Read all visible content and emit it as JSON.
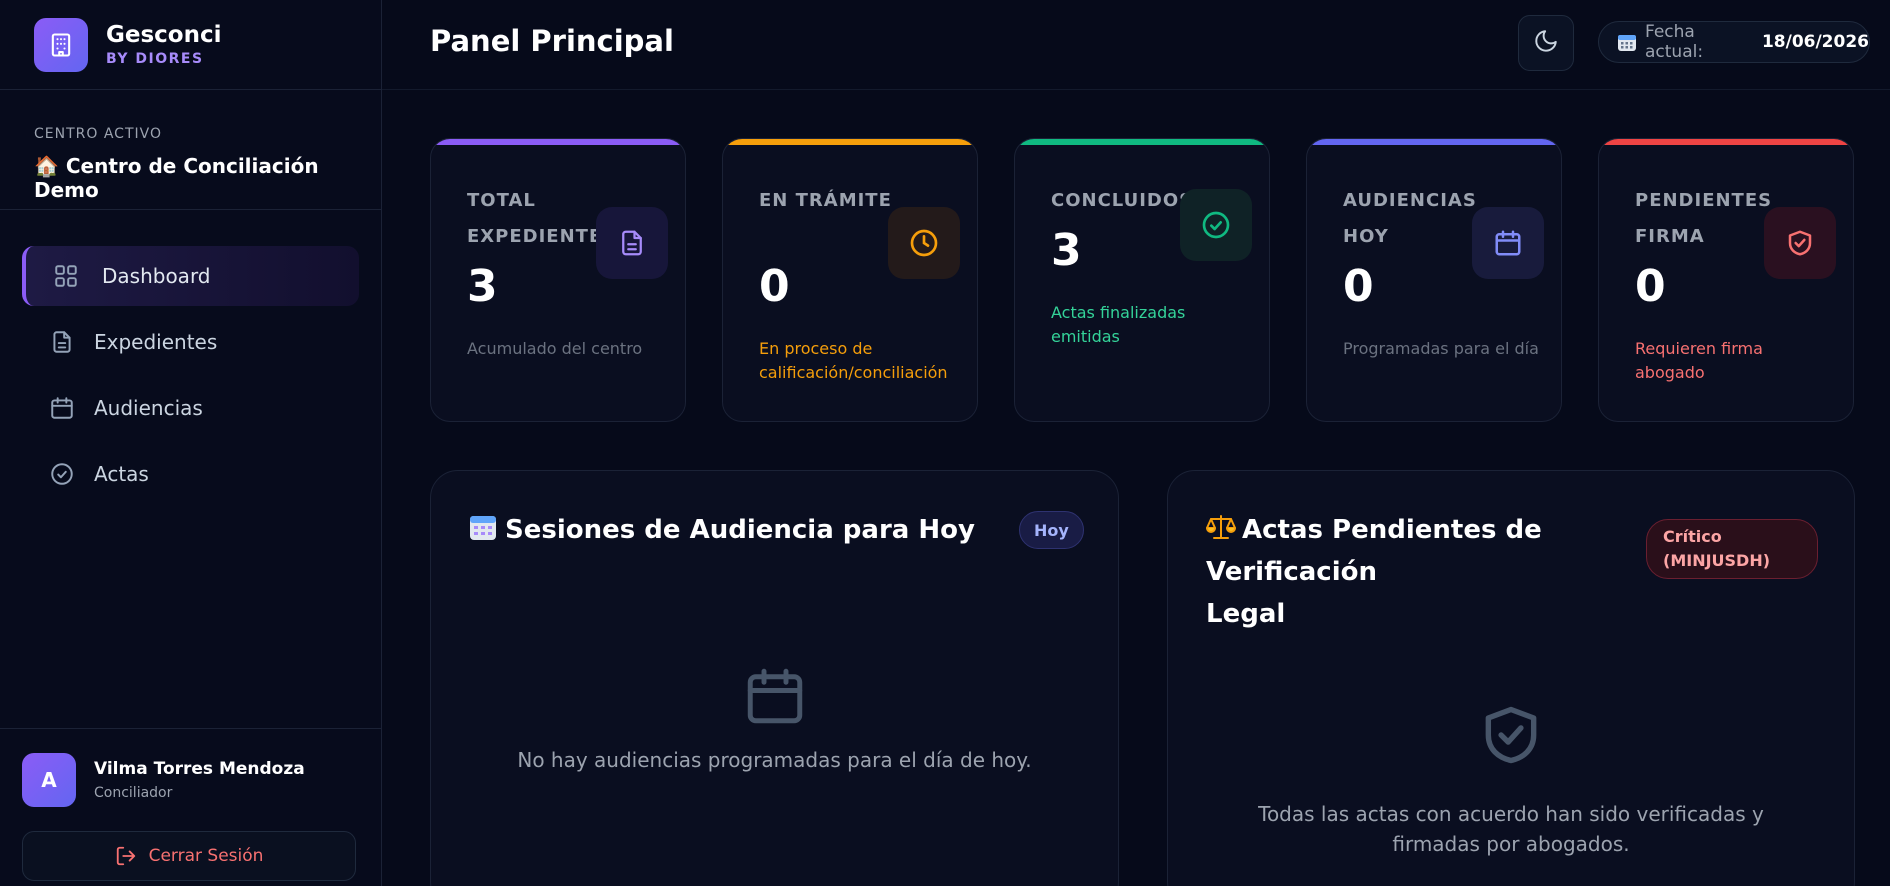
{
  "brand": {
    "name": "Gesconci",
    "subtitle": "BY DIORES"
  },
  "center": {
    "label": "CENTRO ACTIVO",
    "name": "🏠 Centro de Conciliación Demo"
  },
  "nav": [
    {
      "label": "Dashboard",
      "icon": "dashboard-grid-icon",
      "active": true
    },
    {
      "label": "Expedientes",
      "icon": "document-icon",
      "active": false
    },
    {
      "label": "Audiencias",
      "icon": "calendar-icon",
      "active": false
    },
    {
      "label": "Actas",
      "icon": "check-circle-icon",
      "active": false
    }
  ],
  "user": {
    "initial": "A",
    "name": "Vilma Torres Mendoza",
    "role": "Conciliador"
  },
  "logout": {
    "label": "Cerrar Sesión"
  },
  "header": {
    "title": "Panel Principal",
    "date_label": "Fecha actual:",
    "date_value": "18/06/2026"
  },
  "stats": [
    {
      "label": "TOTAL EXPEDIENTES",
      "value": "3",
      "desc": "Acumulado del centro",
      "color": "#8b5cf6",
      "icon": "document-icon"
    },
    {
      "label": "EN TRÁMITE",
      "value": "0",
      "desc": "En proceso de calificación/conciliación",
      "color": "#f59e0b",
      "icon": "clock-icon"
    },
    {
      "label": "CONCLUIDOS",
      "value": "3",
      "desc": "Actas finalizadas emitidas",
      "color": "#10b981",
      "icon": "check-circle-icon"
    },
    {
      "label": "AUDIENCIAS HOY",
      "value": "0",
      "desc": "Programadas para el día",
      "color": "#6366f1",
      "icon": "calendar-icon"
    },
    {
      "label": "PENDIENTES FIRMA",
      "value": "0",
      "desc": "Requieren firma abogado",
      "color": "#ef4444",
      "icon": "shield-check-icon"
    }
  ],
  "sessions_panel": {
    "title": "Sesiones de Audiencia para Hoy",
    "badge": "Hoy",
    "empty_text": "No hay audiencias programadas para el día de hoy."
  },
  "actas_panel": {
    "title_line1": "Actas Pendientes de Verificación",
    "title_line2": "Legal",
    "badge_line1": "Crítico",
    "badge_line2": "(MINJUSDH)",
    "empty_text": "Todas las actas con acuerdo han sido verificadas y firmadas por abogados."
  }
}
